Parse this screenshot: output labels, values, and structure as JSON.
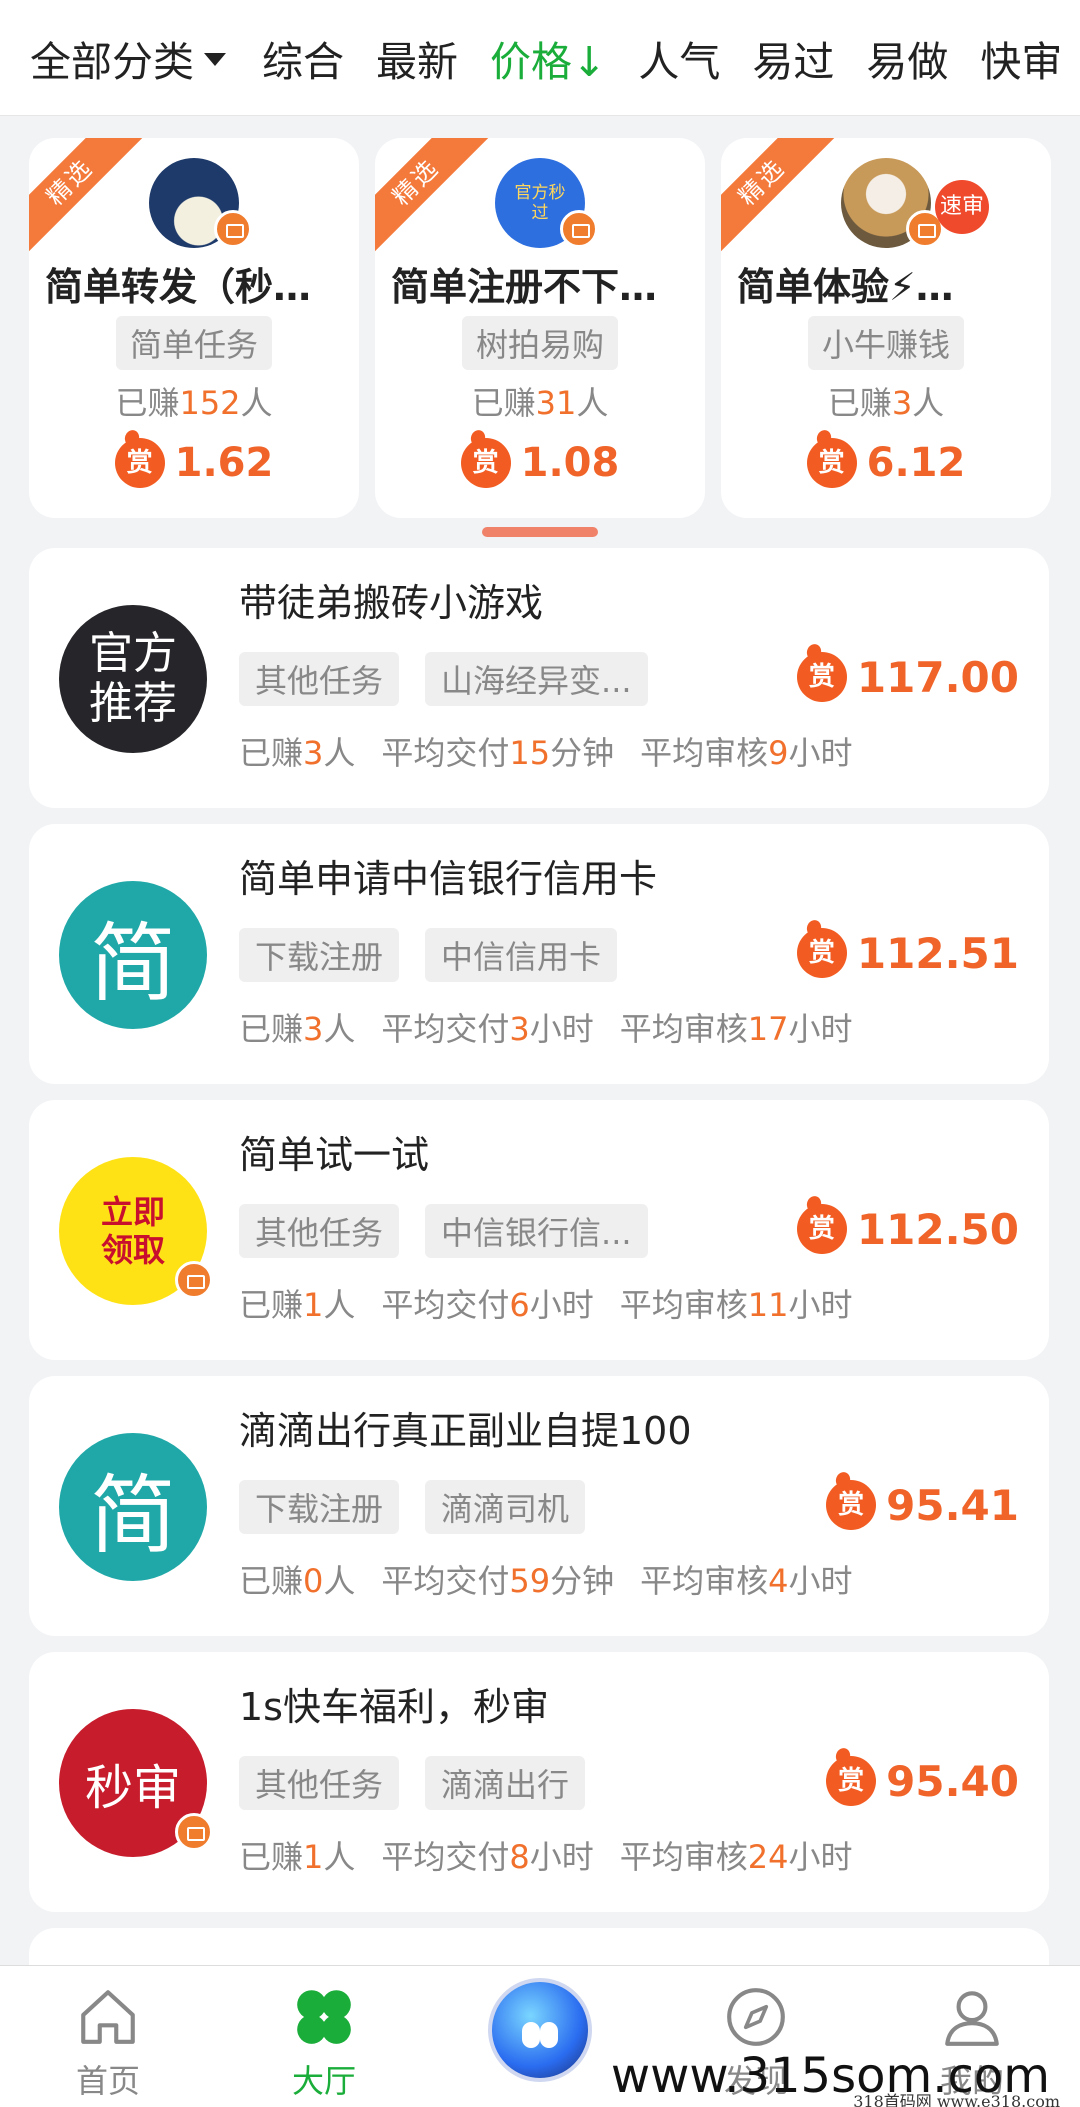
{
  "filters": {
    "all_categories": "全部分类",
    "items": [
      "综合",
      "最新",
      "价格↓",
      "人气",
      "易过",
      "易做",
      "快审"
    ]
  },
  "featured": [
    {
      "ribbon": "精选",
      "title": "简单转发（秒…",
      "tag": "简单任务",
      "earned_prefix": "已赚",
      "earned_count": "152",
      "earned_suffix": "人",
      "reward_label": "赏",
      "price": "1.62"
    },
    {
      "ribbon": "精选",
      "avatar_text": "官方秒过",
      "title": "简单注册不下…",
      "tag": "树拍易购",
      "earned_prefix": "已赚",
      "earned_count": "31",
      "earned_suffix": "人",
      "reward_label": "赏",
      "price": "1.08"
    },
    {
      "ribbon": "精选",
      "badge": "速审",
      "title": "简单体验⚡…",
      "tag": "小牛赚钱",
      "earned_prefix": "已赚",
      "earned_count": "3",
      "earned_suffix": "人",
      "reward_label": "赏",
      "price": "6.12"
    }
  ],
  "tasks": [
    {
      "avatar_text": "官方推荐",
      "title": "带徒弟搬砖小游戏",
      "tags": [
        "其他任务",
        "山海经异变..."
      ],
      "price": "117.00",
      "earned": "3",
      "deliver_val": "15",
      "deliver_unit": "分钟",
      "review_val": "9",
      "review_unit": "小时"
    },
    {
      "avatar_text": "简",
      "title": "简单申请中信银行信用卡",
      "tags": [
        "下载注册",
        "中信信用卡"
      ],
      "price": "112.51",
      "earned": "3",
      "deliver_val": "3",
      "deliver_unit": "小时",
      "review_val": "17",
      "review_unit": "小时"
    },
    {
      "avatar_text": "立即领取",
      "title": "简单试一试",
      "tags": [
        "其他任务",
        "中信银行信..."
      ],
      "price": "112.50",
      "earned": "1",
      "deliver_val": "6",
      "deliver_unit": "小时",
      "review_val": "11",
      "review_unit": "小时"
    },
    {
      "avatar_text": "简",
      "title": "滴滴出行真正副业自提100",
      "tags": [
        "下载注册",
        "滴滴司机"
      ],
      "price": "95.41",
      "earned": "0",
      "deliver_val": "59",
      "deliver_unit": "分钟",
      "review_val": "4",
      "review_unit": "小时"
    },
    {
      "avatar_text": "秒审",
      "title": "1s快车福利，秒审",
      "tags": [
        "其他任务",
        "滴滴出行"
      ],
      "price": "95.40",
      "earned": "1",
      "deliver_val": "8",
      "deliver_unit": "小时",
      "review_val": "24",
      "review_unit": "小时"
    }
  ],
  "labels": {
    "reward": "赏",
    "earned_prefix": "已赚",
    "earned_suffix": "人",
    "deliver_prefix": "平均交付",
    "review_prefix": "平均审核"
  },
  "nav": {
    "home": "首页",
    "hall": "大厅",
    "discover": "发现",
    "mine": "我的"
  },
  "watermark": {
    "main": "www.315som.com",
    "small": "318首码网  www.e318.com"
  },
  "colors": {
    "accent_green": "#1aad3a",
    "price_orange": "#f0642a"
  }
}
